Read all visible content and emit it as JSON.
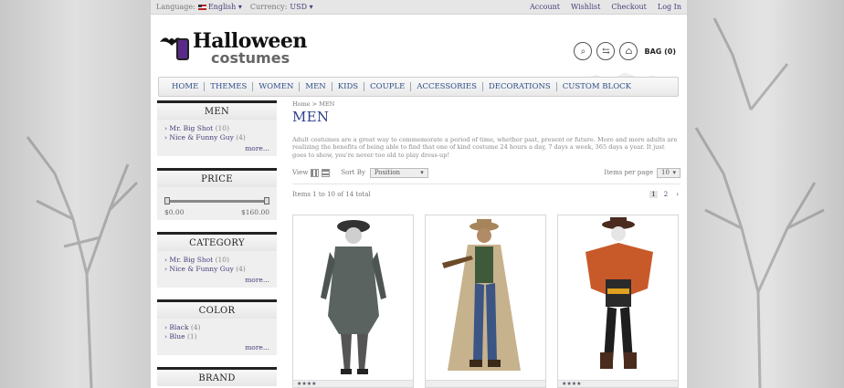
{
  "topbar": {
    "language_label": "Language:",
    "language_value": "English",
    "currency_label": "Currency:",
    "currency_value": "USD",
    "links": [
      "Account",
      "Wishlist",
      "Checkout",
      "Log In"
    ]
  },
  "header": {
    "logo_line1": "Halloween",
    "logo_line2": "costumes",
    "bag_label": "BAG (0)"
  },
  "nav": [
    "HOME",
    "THEMES",
    "WOMEN",
    "MEN",
    "KIDS",
    "COUPLE",
    "ACCESSORIES",
    "DECORATIONS",
    "CUSTOM BLOCK"
  ],
  "sidebar": {
    "men": {
      "title": "MEN",
      "items": [
        {
          "label": "Mr. Big Shot",
          "count": "(10)"
        },
        {
          "label": "Nice & Funny Guy",
          "count": "(4)"
        }
      ],
      "more": "more..."
    },
    "price": {
      "title": "PRICE",
      "min": "$0.00",
      "max": "$160.00"
    },
    "category": {
      "title": "CATEGORY",
      "items": [
        {
          "label": "Mr. Big Shot",
          "count": "(10)"
        },
        {
          "label": "Nice & Funny Guy",
          "count": "(4)"
        }
      ],
      "more": "more..."
    },
    "color": {
      "title": "COLOR",
      "items": [
        {
          "label": "Black",
          "count": "(4)"
        },
        {
          "label": "Blue",
          "count": "(1)"
        }
      ],
      "more": "more..."
    },
    "brand": {
      "title": "BRAND"
    }
  },
  "main": {
    "breadcrumb_home": "Home",
    "breadcrumb_sep": ">",
    "breadcrumb_current": "MEN",
    "title": "MEN",
    "description": "Adult costumes are a great way to commemorate a period of time, whether past, present or future. More and more adults are realizing the benefits of being able to find that one of kind costume 24 hours a day, 7 days a week, 365 days a year. It just goes to show, you're never too old to play dress-up!",
    "view_label": "View",
    "sort_label": "Sort By",
    "sort_value": "Position",
    "ipp_label": "Items per page",
    "ipp_value": "10",
    "items_total": "Items 1 to 10 of 14 total",
    "pages": [
      "1",
      "2"
    ],
    "current_page": "1"
  },
  "colors": {
    "link": "#4a3c7a",
    "nav": "#2e4f8a",
    "title": "#2e3f8a"
  }
}
